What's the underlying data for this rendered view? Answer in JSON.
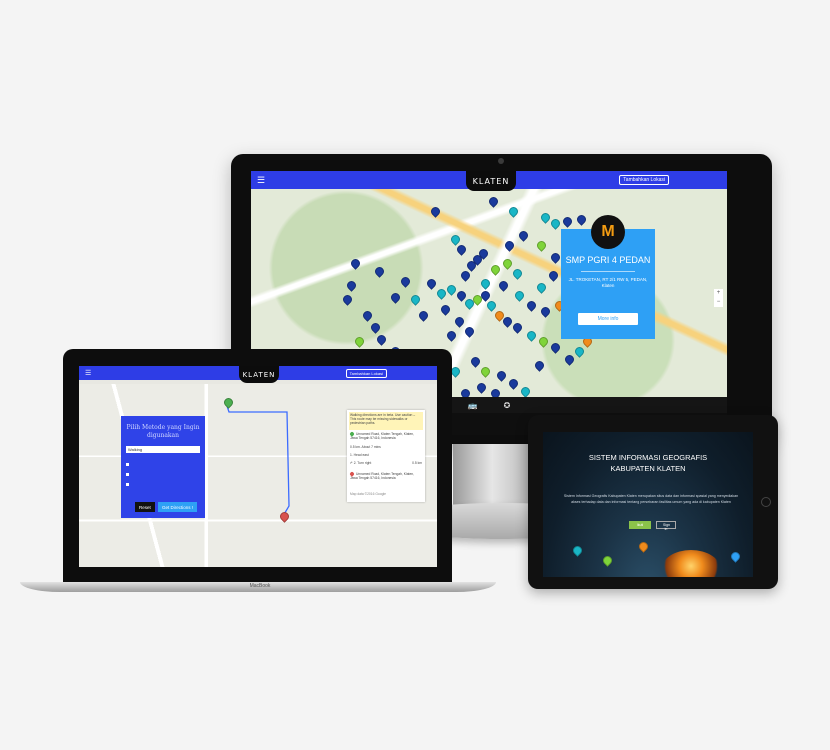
{
  "monitor": {
    "brand": "KLATEN",
    "add_location": "Tambahkan Lokasi",
    "menu_glyph": "☰",
    "popup": {
      "title": "SMP PGRI 4 PEDAN",
      "address": "JL. TROKETAN, RT 2/1 RW 5, PEDAN, Klaten",
      "more_info": "More info"
    },
    "zoom_in": "+",
    "zoom_out": "−"
  },
  "laptop": {
    "brand": "KLATEN",
    "add_location": "Tambahkan Lokasi",
    "menu_glyph": "☰",
    "device_label": "MacBook",
    "directions": {
      "title": "Pilih Metode yang Ingin digunakan",
      "mode": "Walking",
      "reset": "Reset",
      "get": "Get Directions !"
    },
    "route": {
      "warning": "Walking directions are in beta. Use caution – This route may be missing sidewalks or pedestrian paths.",
      "start": "Unnamed Road, Klaten Tengah, Klaten, Jawa Tengah 57416, Indonesia",
      "summary": "0.5 km. About 7 mins",
      "step1": "1. Head east",
      "step2": "2. Turn right",
      "step2_dist": "0.5 km",
      "destination": "Unnamed Road, Klaten Tengah, Klaten, Jawa Tengah 57416, Indonesia",
      "footer": "Map data ©2016 Google"
    }
  },
  "tablet": {
    "title_line1": "SISTEM INFORMASI GEOGRAFIS",
    "title_line2": "KABUPATEN KLATEN",
    "description": "Sistem Informasi Geografis Kabupaten Klaten merupakan situs data dan informasi spasial yang menyediakan akses terhadap data dan informasi tentang persebaran fasilitas umum yang ada di kabupaten Klaten",
    "btn_primary": "Ikuti",
    "btn_secondary": "Sign in"
  },
  "colors": {
    "header_blue": "#2e3de6",
    "popup_blue": "#2ea0f5",
    "pin_navy": "#1a3a9c",
    "pin_teal": "#19b6c6",
    "pin_green": "#7fd43a",
    "pin_orange": "#f08b1c"
  }
}
